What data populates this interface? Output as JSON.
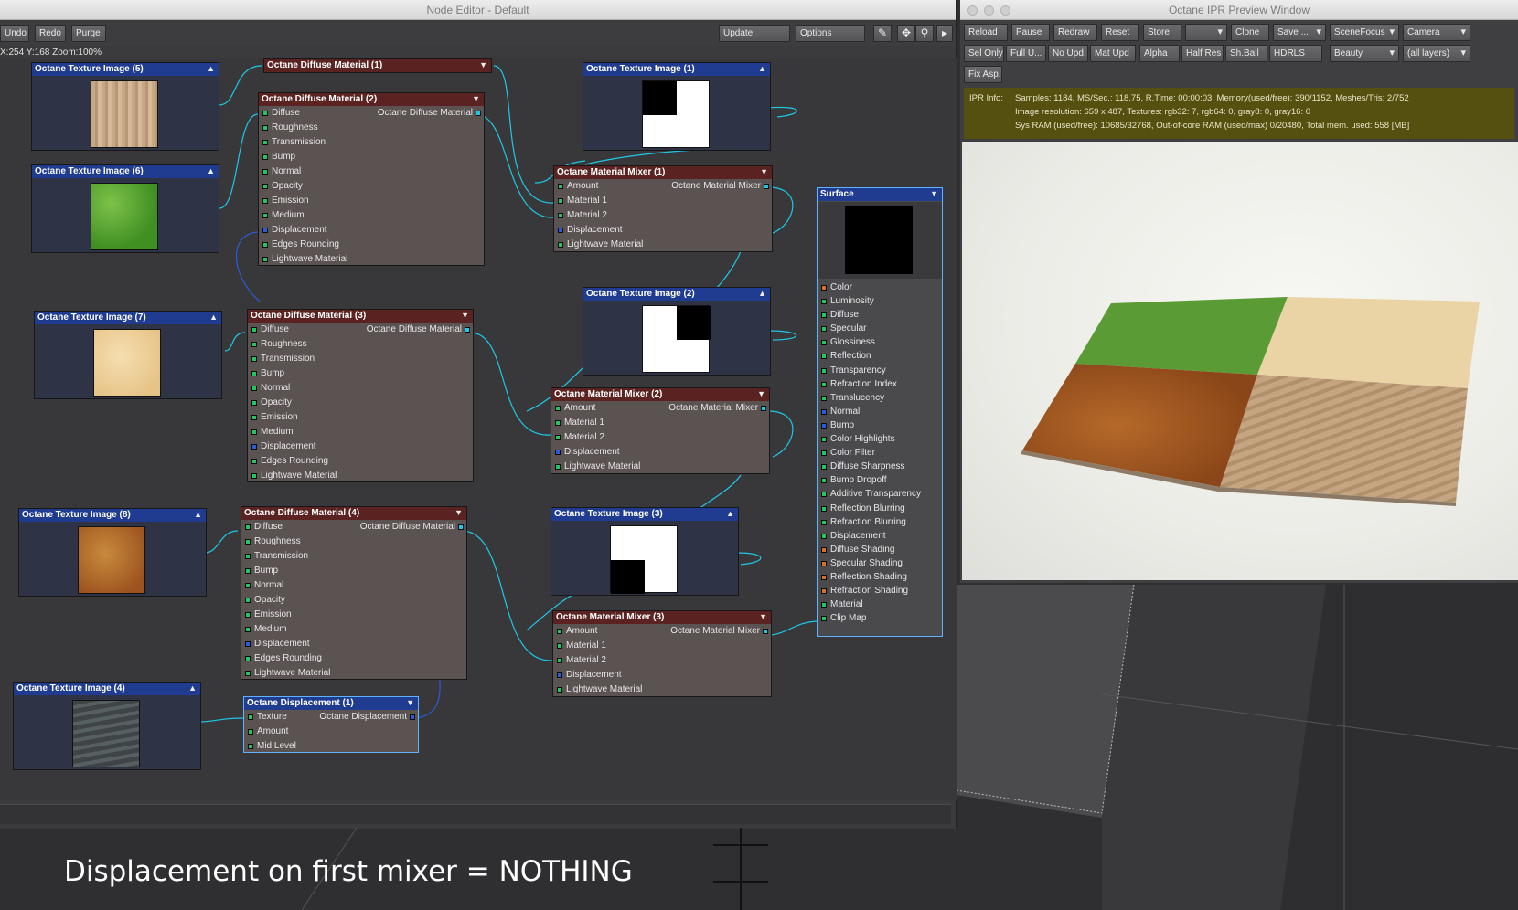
{
  "node_editor": {
    "title": "Node Editor - Default",
    "toolbar": {
      "undo": "Undo",
      "redo": "Redo",
      "purge": "Purge",
      "update": "Update",
      "options": "Options"
    },
    "coords": "X:254 Y:168 Zoom:100%"
  },
  "nodes": {
    "tex5": {
      "title": "Octane Texture Image (5)"
    },
    "tex6": {
      "title": "Octane Texture Image (6)"
    },
    "tex7": {
      "title": "Octane Texture Image (7)"
    },
    "tex8": {
      "title": "Octane Texture Image (8)"
    },
    "tex4": {
      "title": "Octane Texture Image (4)"
    },
    "tex1": {
      "title": "Octane Texture Image (1)"
    },
    "tex2": {
      "title": "Octane Texture Image (2)"
    },
    "tex3": {
      "title": "Octane Texture Image (3)"
    },
    "diff1": {
      "title": "Octane Diffuse Material (1)"
    },
    "diff2": {
      "title": "Octane Diffuse Material (2)",
      "output": "Octane Diffuse Material"
    },
    "diff3": {
      "title": "Octane Diffuse Material (3)",
      "output": "Octane Diffuse Material"
    },
    "diff4": {
      "title": "Octane Diffuse Material (4)",
      "output": "Octane Diffuse Material"
    },
    "diffuse_inputs": [
      "Diffuse",
      "Roughness",
      "Transmission",
      "Bump",
      "Normal",
      "Opacity",
      "Emission",
      "Medium",
      "Displacement",
      "Edges Rounding",
      "Lightwave Material"
    ],
    "mix1": {
      "title": "Octane Material Mixer (1)",
      "output": "Octane Material Mixer"
    },
    "mix2": {
      "title": "Octane Material Mixer (2)",
      "output": "Octane Material Mixer"
    },
    "mix3": {
      "title": "Octane Material Mixer (3)",
      "output": "Octane Material Mixer"
    },
    "mixer_inputs": [
      "Amount",
      "Material 1",
      "Material 2",
      "Displacement",
      "Lightwave Material"
    ],
    "disp1": {
      "title": "Octane Displacement (1)",
      "output": "Octane Displacement",
      "inputs": [
        "Texture",
        "Amount",
        "Mid Level"
      ]
    },
    "surface": {
      "title": "Surface",
      "inputs": [
        "Color",
        "Luminosity",
        "Diffuse",
        "Specular",
        "Glossiness",
        "Reflection",
        "Transparency",
        "Refraction Index",
        "Translucency",
        "Normal",
        "Bump",
        "Color Highlights",
        "Color Filter",
        "Diffuse Sharpness",
        "Bump Dropoff",
        "Additive Transparency",
        "Reflection Blurring",
        "Refraction Blurring",
        "Displacement",
        "Diffuse Shading",
        "Specular Shading",
        "Reflection Shading",
        "Refraction Shading",
        "Material",
        "Clip Map"
      ]
    }
  },
  "ipr": {
    "title": "Octane IPR Preview Window",
    "row1": [
      "Reload",
      "Pause",
      "Redraw",
      "Reset",
      "Store",
      "",
      "Clone",
      "Save ...",
      "SceneFocus",
      "Camera"
    ],
    "row2": [
      "Sel Only",
      "Full U...",
      "No Upd.",
      "Mat Upd",
      "Alpha",
      "Half Res",
      "Sh.Ball",
      "HDRLS",
      "Beauty",
      "(all layers)"
    ],
    "row3": [
      "Fix Asp."
    ],
    "info_label": "IPR Info:",
    "info_lines": [
      "Samples: 1184, MS/Sec.: 118.75, R.Time: 00:00:03, Memory(used/free): 390/1152, Meshes/Tris: 2/752",
      "Image resolution: 659 x 487, Textures:  rgb32: 7, rgb64: 0, gray8: 0, gray16: 0",
      "Sys RAM (used/free): 10685/32768, Out-of-core RAM (used/max) 0/20480, Total mem. used: 558  [MB]"
    ]
  },
  "caption": "Displacement on first mixer = NOTHING",
  "colors": {
    "accent_wire": "#1ec8e8",
    "node_header_texture": "#1f3c90",
    "node_header_material": "#5a2220",
    "info_bar": "#565010"
  }
}
